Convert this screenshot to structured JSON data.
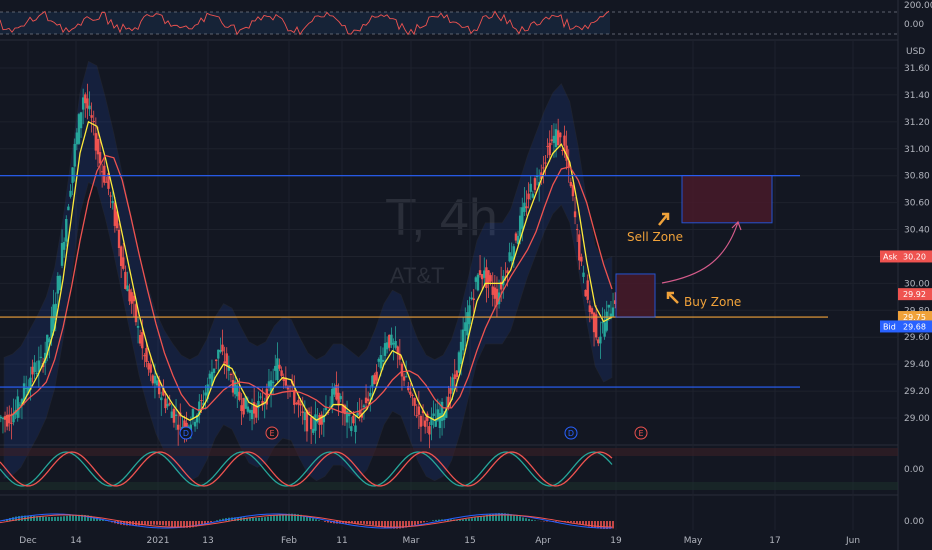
{
  "watermark": {
    "symbol": "T, 4h",
    "company": "AT&T"
  },
  "price_axis": {
    "unit": "USD",
    "ticks": [
      "31.60",
      "31.40",
      "31.20",
      "31.00",
      "30.80",
      "30.60",
      "30.40",
      "30.20",
      "30.00",
      "29.80",
      "29.60",
      "29.40",
      "29.20",
      "29.00"
    ],
    "tick_values": [
      31.6,
      31.4,
      31.2,
      31.0,
      30.8,
      30.6,
      30.4,
      30.2,
      30.0,
      29.8,
      29.6,
      29.4,
      29.2,
      29.0
    ]
  },
  "price_tags": [
    {
      "name": "ask",
      "label": "Ask",
      "value": "30.20",
      "color": "#ef5350"
    },
    {
      "name": "last",
      "label": "",
      "value": "29.92",
      "color": "#ef5350"
    },
    {
      "name": "level",
      "label": "",
      "value": "29.75",
      "color": "#f0a23a"
    },
    {
      "name": "bid",
      "label": "Bid",
      "value": "29.68",
      "color": "#2962ff"
    }
  ],
  "rsi_axis": {
    "ticks": [
      "200.00",
      "0.00"
    ]
  },
  "stoch_axis": {
    "ticks": [
      "0.00"
    ]
  },
  "macd_axis": {
    "ticks": [
      "0.00"
    ]
  },
  "time_axis": {
    "labels": [
      "Dec",
      "14",
      "2021",
      "13",
      "Feb",
      "11",
      "Mar",
      "15",
      "Apr",
      "19",
      "May",
      "17",
      "Jun"
    ]
  },
  "annotations": {
    "sell_zone": "Sell Zone",
    "buy_zone": "Buy Zone"
  },
  "event_markers": [
    "D",
    "E",
    "D",
    "E"
  ],
  "colors": {
    "background": "#131722",
    "up": "#26a69a",
    "down": "#ef5350",
    "resistance": "#2962ff",
    "support_orange": "#f0a23a",
    "ma_fast": "#ffeb3b",
    "ma_slow": "#ef5350"
  },
  "chart_data": {
    "type": "candlestick",
    "interval": "4h",
    "y_range": [
      28.9,
      31.7
    ],
    "horizontal_levels": [
      {
        "name": "resistance",
        "value": 30.8,
        "color": "#2962ff"
      },
      {
        "name": "support",
        "value": 29.75,
        "color": "#f0a23a"
      },
      {
        "name": "lower-support",
        "value": 29.23,
        "color": "#2962ff"
      }
    ],
    "zones": [
      {
        "name": "Sell Zone",
        "y_top": 30.8,
        "y_bottom": 30.45
      },
      {
        "name": "Buy Zone",
        "y_top": 30.07,
        "y_bottom": 29.75
      }
    ],
    "close_series": [
      29.0,
      29.05,
      29.2,
      29.35,
      29.4,
      29.6,
      30.0,
      30.5,
      31.0,
      31.4,
      31.2,
      30.9,
      30.7,
      30.4,
      30.0,
      29.8,
      29.5,
      29.3,
      29.2,
      29.1,
      29.0,
      28.95,
      29.0,
      29.1,
      29.3,
      29.5,
      29.4,
      29.2,
      29.1,
      29.05,
      29.1,
      29.2,
      29.4,
      29.3,
      29.15,
      29.0,
      28.95,
      29.0,
      29.1,
      29.2,
      29.0,
      28.95,
      29.05,
      29.2,
      29.4,
      29.6,
      29.5,
      29.3,
      29.1,
      29.0,
      28.95,
      29.0,
      29.1,
      29.3,
      29.6,
      29.9,
      30.1,
      30.0,
      29.9,
      30.1,
      30.3,
      30.5,
      30.7,
      30.8,
      31.0,
      31.1,
      31.0,
      30.6,
      30.1,
      29.8,
      29.6,
      29.75,
      29.9
    ]
  }
}
